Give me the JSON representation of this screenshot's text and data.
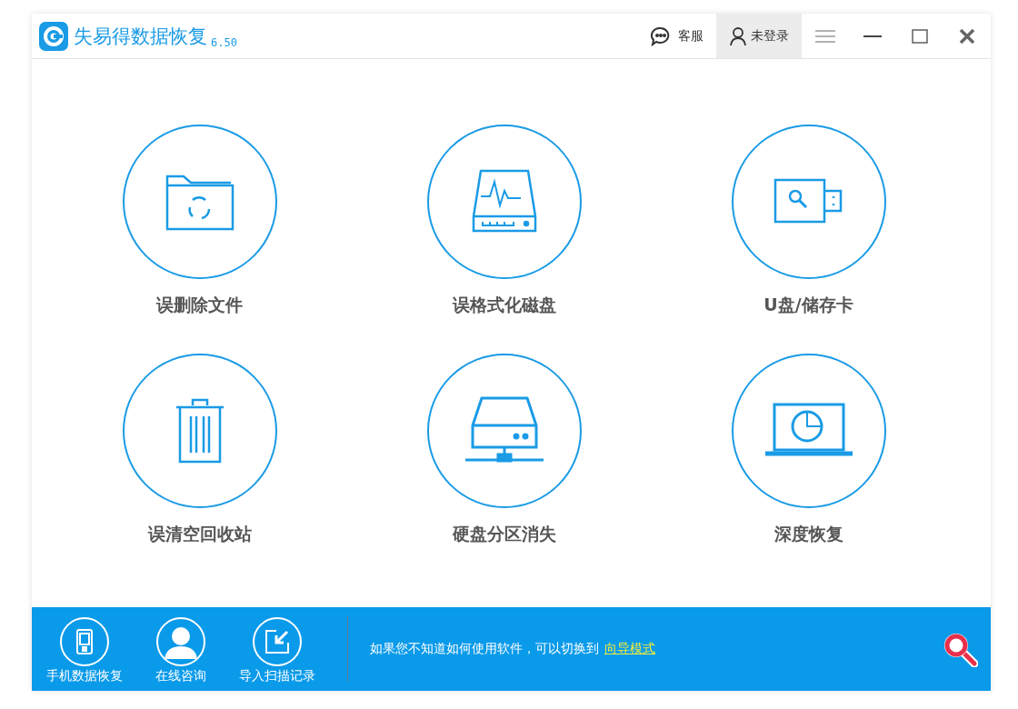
{
  "window": {
    "title": "失易得数据恢复",
    "version": "6.50"
  },
  "title_bar": {
    "service_label": "客服",
    "account": {
      "label": "未登录",
      "highlighted": true
    }
  },
  "tiles": [
    {
      "kind": "folder",
      "label": "误删除文件"
    },
    {
      "kind": "disk",
      "label": "误格式化磁盘"
    },
    {
      "kind": "usb",
      "label": "U盘/储存卡"
    },
    {
      "kind": "trash",
      "label": "误清空回收站"
    },
    {
      "kind": "drive",
      "label": "硬盘分区消失"
    },
    {
      "kind": "laptop",
      "label": "深度恢复"
    }
  ],
  "bottom_bar": {
    "tools": [
      {
        "kind": "phone",
        "label": "手机数据恢复"
      },
      {
        "kind": "person",
        "label": "在线咨询"
      },
      {
        "kind": "import",
        "label": "导入扫描记录"
      }
    ],
    "hint": "如果您不知道如何使用软件，可以切换到",
    "link": "向导模式"
  }
}
